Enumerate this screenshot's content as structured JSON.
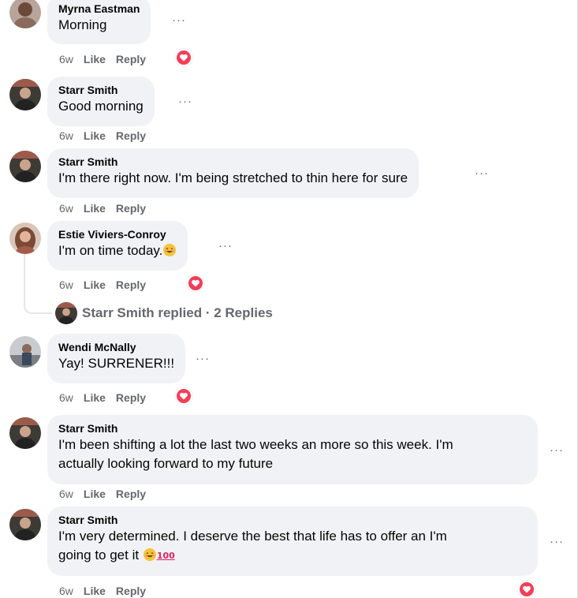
{
  "comments": [
    {
      "author": "Myrna Eastman",
      "text": "Morning",
      "time": "6w",
      "like": "Like",
      "reply": "Reply",
      "more": "···"
    },
    {
      "author": "Starr Smith",
      "text": "Good morning",
      "time": "6w",
      "like": "Like",
      "reply": "Reply",
      "more": "···"
    },
    {
      "author": "Starr Smith",
      "text": "I'm there right now. I'm being stretched to thin here for sure",
      "time": "6w",
      "like": "Like",
      "reply": "Reply",
      "more": "···"
    },
    {
      "author": "Estie Viviers-Conroy",
      "text": "I'm on time today.",
      "time": "6w",
      "like": "Like",
      "reply": "Reply",
      "more": "···"
    },
    {
      "author": "Wendi McNally",
      "text": "Yay! SURRENER!!!",
      "time": "6w",
      "like": "Like",
      "reply": "Reply",
      "more": "···"
    },
    {
      "author": "Starr Smith",
      "text_line1": "I'm been shifting a lot the last two weeks an more so this week. I'm",
      "text_line2": "actually looking forward to my future",
      "time": "6w",
      "like": "Like",
      "reply": "Reply",
      "more": "···"
    },
    {
      "author": "Starr Smith",
      "text_line1": "I'm very determined. I deserve the best that life has to offer an I'm",
      "text_line2": "going to get it",
      "time": "6w",
      "like": "Like",
      "reply": "Reply",
      "more": "···"
    }
  ],
  "replies_summary": "Starr Smith replied · 2 Replies",
  "emoji": {
    "hundred": "100"
  },
  "icons": {
    "reaction": "heart-icon",
    "more": "more-options-icon",
    "emoji": "smiling-face-icon"
  },
  "colors": {
    "bubble": "#f0f2f5",
    "secondary_text": "#65676b",
    "heart": "#f33e58"
  }
}
